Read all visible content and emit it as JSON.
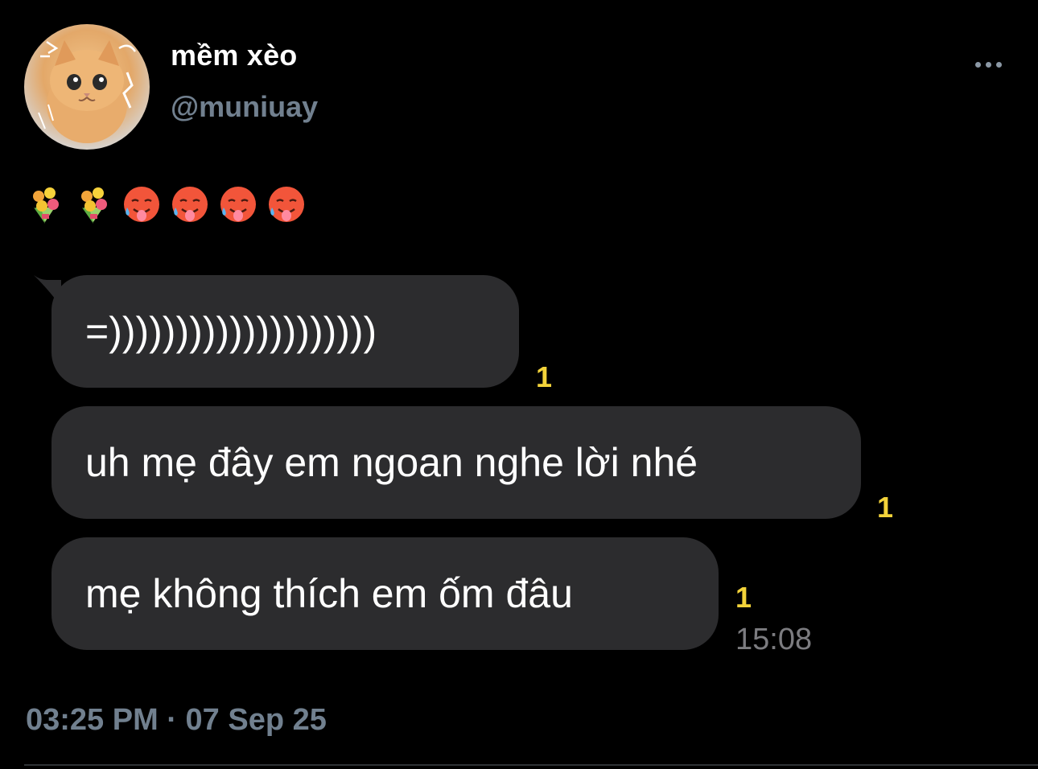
{
  "tweet": {
    "display_name": "mềm xèo",
    "handle": "@muniuay",
    "body_emoji": [
      "bouquet",
      "bouquet",
      "hot-face",
      "hot-face",
      "hot-face",
      "hot-face"
    ],
    "timestamp": "03:25 PM · 07 Sep 25"
  },
  "chat_screenshot": {
    "messages": [
      {
        "text": "=))))))))))))))))))))",
        "unread_count": "1"
      },
      {
        "text": "uh mẹ đây em ngoan nghe lời nhé",
        "unread_count": "1"
      },
      {
        "text": "mẹ không thích em ốm đâu",
        "unread_count": "1"
      }
    ],
    "last_message_time": "15:08"
  },
  "colors": {
    "background": "#000000",
    "bubble": "#2c2c2e",
    "unread_badge": "#f3d33a",
    "muted_text": "#71808f"
  }
}
